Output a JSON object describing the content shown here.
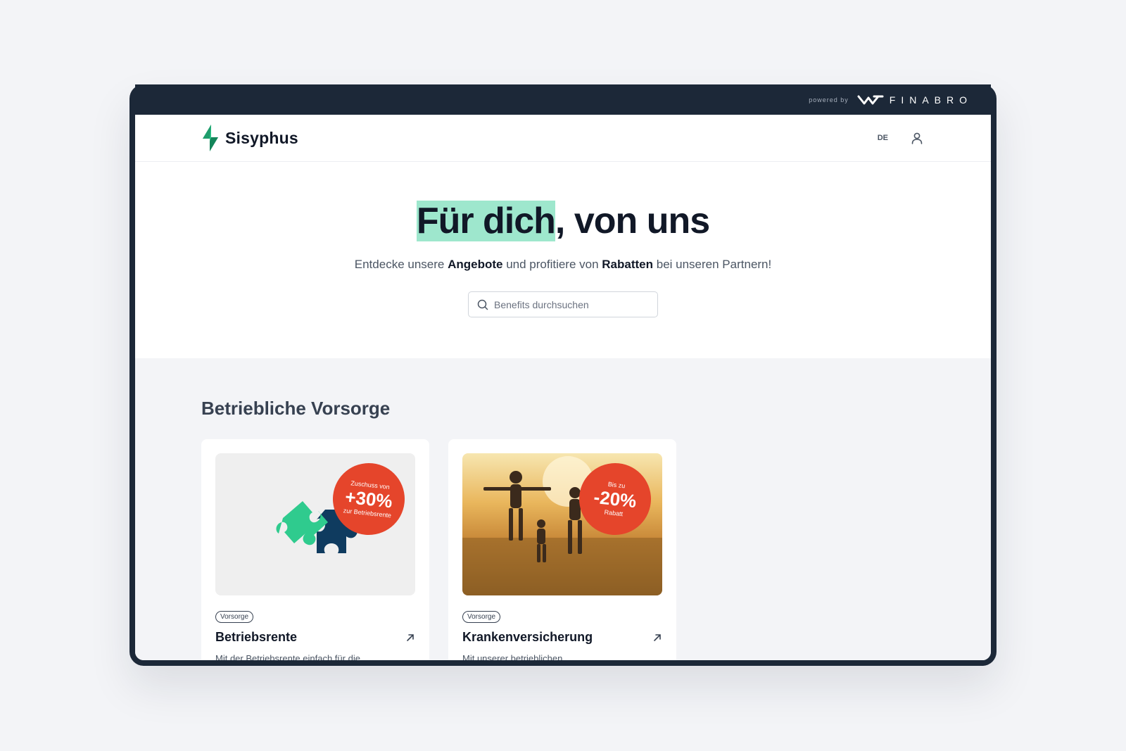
{
  "topbar": {
    "powered_by": "powered by",
    "brand": "FINABRO"
  },
  "header": {
    "logo_text": "Sisyphus",
    "language": "DE"
  },
  "hero": {
    "title_highlight": "Für dich",
    "title_rest": ", von uns",
    "subtitle_1": "Entdecke unsere ",
    "subtitle_bold_1": "Angebote",
    "subtitle_2": " und profitiere von ",
    "subtitle_bold_2": "Rabatten",
    "subtitle_3": " bei unseren Partnern!",
    "search_placeholder": "Benefits durchsuchen"
  },
  "section": {
    "title": "Betriebliche Vorsorge",
    "cards": [
      {
        "badge_top": "Zuschuss von",
        "badge_value": "+30%",
        "badge_bottom": "zur Betriebsrente",
        "tag": "Vorsorge",
        "title": "Betriebsrente",
        "description": "Mit der Betriebsrente einfach für die"
      },
      {
        "badge_top": "Bis zu",
        "badge_value": "-20%",
        "badge_bottom": "Rabatt",
        "tag": "Vorsorge",
        "title": "Krankenversicherung",
        "description": "Mit unserer betrieblichen"
      }
    ]
  },
  "colors": {
    "accent_green": "#2fcb8e",
    "highlight": "#9ee7cd",
    "badge_red": "#e5452b",
    "dark": "#1c2838"
  }
}
